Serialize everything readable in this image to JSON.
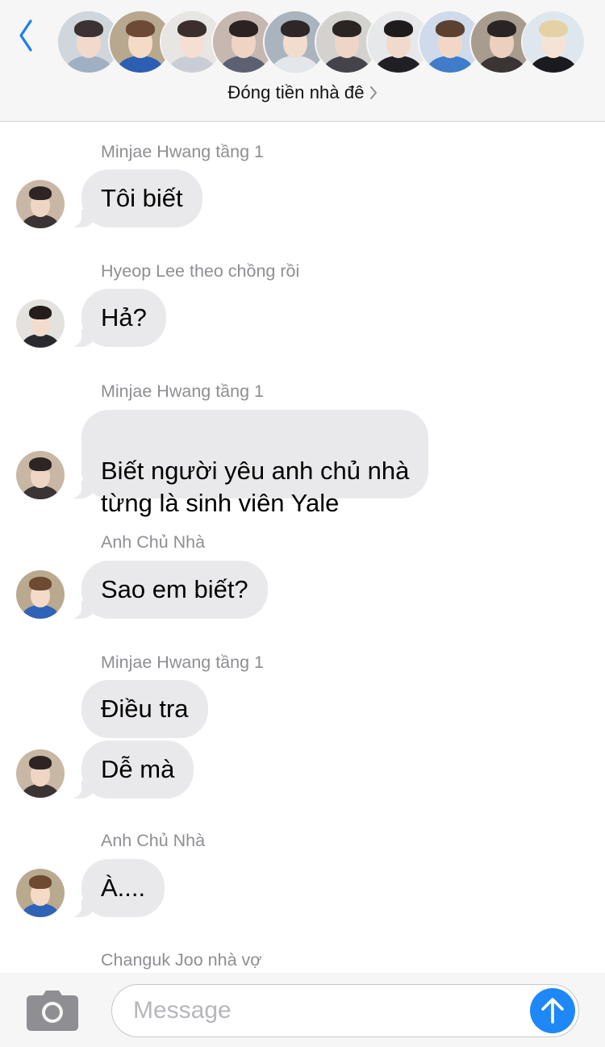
{
  "header": {
    "back_icon": "chevron-left-icon",
    "group_name": "Đóng tiền nhà đê",
    "chevron_icon": "chevron-right-icon",
    "accent_color": "#1a7ff5",
    "member_avatars": [
      {
        "name": "member-avatar-1",
        "palette": [
          "#cfd6dc",
          "#3a3233",
          "#f1d9cc",
          "#9fb0c2"
        ]
      },
      {
        "name": "member-avatar-2",
        "palette": [
          "#b7a88f",
          "#6c4a36",
          "#f3dbc8",
          "#2c5fb3"
        ]
      },
      {
        "name": "member-avatar-3",
        "palette": [
          "#e8e6e3",
          "#3b2f2c",
          "#f4dfd2",
          "#c9ced6"
        ]
      },
      {
        "name": "member-avatar-4",
        "palette": [
          "#c6b7b1",
          "#2b2322",
          "#efd4c3",
          "#5b6170"
        ]
      },
      {
        "name": "member-avatar-5",
        "palette": [
          "#a9b4bf",
          "#2e2728",
          "#f2dccd",
          "#e3e6ea"
        ]
      },
      {
        "name": "member-avatar-6",
        "palette": [
          "#d4d2cf",
          "#2a2423",
          "#efd5c6",
          "#434349"
        ]
      },
      {
        "name": "member-avatar-7",
        "palette": [
          "#e7e8ea",
          "#1e1b1c",
          "#f1dacb",
          "#1f1f24"
        ]
      },
      {
        "name": "member-avatar-8",
        "palette": [
          "#cfdaeb",
          "#5a4130",
          "#f1d8c6",
          "#3f7cc9"
        ]
      },
      {
        "name": "member-avatar-9",
        "palette": [
          "#a89c8f",
          "#2b2424",
          "#ecd0bd",
          "#3b3434"
        ]
      },
      {
        "name": "member-avatar-10",
        "palette": [
          "#dfe7ee",
          "#e4d2a6",
          "#f5e3d6",
          "#1b1b1f"
        ]
      }
    ]
  },
  "messages": [
    {
      "sender": "Minjae Hwang tầng 1",
      "bubbles": [
        "Tôi biết"
      ],
      "avatar": "minjae"
    },
    {
      "sender": "Hyeop Lee theo chồng rồi",
      "bubbles": [
        "Hả?"
      ],
      "avatar": "hyeop"
    },
    {
      "sender": "Minjae Hwang tầng 1",
      "bubbles": [
        "Biết người yêu anh chủ nhà\ntừng là sinh viên Yale"
      ],
      "avatar": "minjae"
    },
    {
      "sender": "Anh Chủ Nhà",
      "bubbles": [
        "Sao em biết?"
      ],
      "avatar": "landlord"
    },
    {
      "sender": "Minjae Hwang tầng 1",
      "bubbles": [
        "Điều tra",
        "Dễ mà"
      ],
      "avatar": "minjae"
    },
    {
      "sender": "Anh Chủ Nhà",
      "bubbles": [
        "À...."
      ],
      "avatar": "landlord"
    },
    {
      "sender": "Changuk Joo nhà vợ",
      "bubbles": [],
      "avatar": "changuk"
    }
  ],
  "avatars": {
    "minjae": [
      "#c9b7a5",
      "#2d2424",
      "#efd6c4",
      "#3b3434"
    ],
    "hyeop": [
      "#e4e2df",
      "#231d1c",
      "#f2dcce",
      "#2a2a2e"
    ],
    "landlord": [
      "#b9a98f",
      "#6e4a32",
      "#f3dbc8",
      "#2f63b5"
    ]
  },
  "composer": {
    "camera_icon": "camera-icon",
    "placeholder": "Message",
    "send_icon": "arrow-up-icon",
    "send_color": "#1e88f6"
  }
}
